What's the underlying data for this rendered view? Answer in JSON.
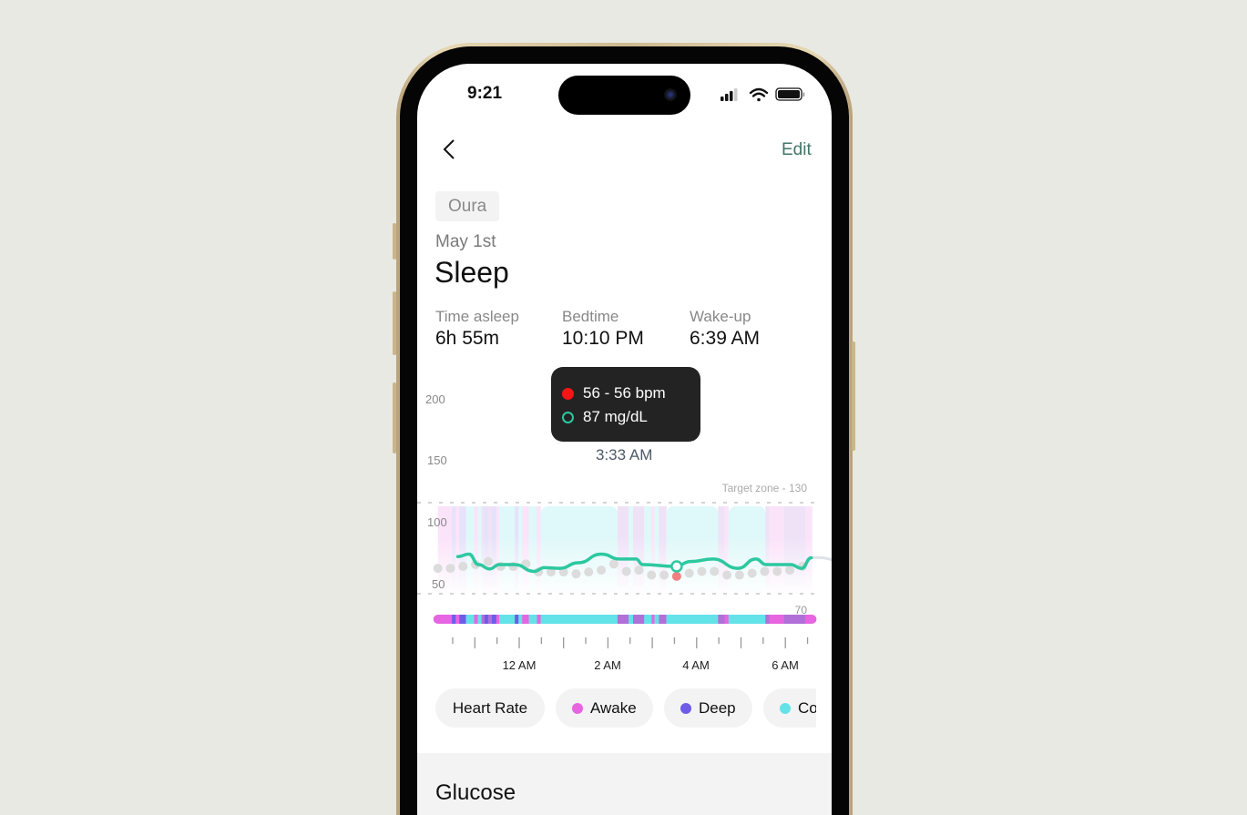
{
  "status_bar": {
    "time": "9:21",
    "icons": [
      "signal-icon",
      "wifi-icon",
      "battery-icon"
    ]
  },
  "nav": {
    "back_icon": "chevron-left-icon",
    "edit_label": "Edit"
  },
  "source_chip": "Oura",
  "date": "May 1st",
  "title": "Sleep",
  "stats": [
    {
      "label": "Time asleep",
      "value": "6h 55m"
    },
    {
      "label": "Bedtime",
      "value": "10:10 PM"
    },
    {
      "label": "Wake-up",
      "value": "6:39 AM"
    }
  ],
  "tooltip": {
    "heart_rate": "56 - 56 bpm",
    "glucose": "87 mg/dL",
    "time": "3:33 AM"
  },
  "legend_pills": [
    {
      "label": "Heart Rate",
      "color": ""
    },
    {
      "label": "Awake",
      "color": "#e765e0"
    },
    {
      "label": "Deep",
      "color": "#6e5ce8"
    },
    {
      "label": "Co",
      "color": "#63e3e8"
    }
  ],
  "next_section_title": "Glucose",
  "colors": {
    "glucose_line": "#2dc8a0",
    "heart_rate_dot": "#dcdcdc",
    "highlight_dot": "#f08080",
    "awake": "#e765e0",
    "deep": "#6e5ce8",
    "core": "#63e3e8",
    "rem": "#b070d8",
    "accent": "#3f7668"
  },
  "chart_data": {
    "type": "line",
    "ylim": [
      50,
      200
    ],
    "y_ticks": [
      "200",
      "150",
      "100",
      "50"
    ],
    "x_ticks": [
      "12 AM",
      "2 AM",
      "4 AM",
      "6 AM"
    ],
    "target_zone_label": "Target zone - 130",
    "stage_bar_label": "70",
    "highlight_time": "03:33",
    "series": [
      {
        "name": "Glucose",
        "unit": "mg/dL",
        "points": [
          [
            "22:37",
            72
          ],
          [
            "22:52",
            74
          ],
          [
            "23:05",
            65.5
          ],
          [
            "23:20",
            62
          ],
          [
            "23:33",
            65.5
          ],
          [
            "23:54",
            65.5
          ],
          [
            "00:20",
            60
          ],
          [
            "00:34",
            63
          ],
          [
            "00:55",
            62.5
          ],
          [
            "01:20",
            67
          ],
          [
            "01:51",
            74
          ],
          [
            "02:16",
            70
          ],
          [
            "02:38",
            70
          ],
          [
            "02:47",
            65.5
          ],
          [
            "03:31",
            64
          ],
          [
            "03:52",
            68
          ],
          [
            "04:22",
            70
          ],
          [
            "04:56",
            62.5
          ],
          [
            "05:20",
            70
          ],
          [
            "05:34",
            65.5
          ],
          [
            "06:07",
            65.5
          ],
          [
            "06:22",
            62.5
          ],
          [
            "06:35",
            71
          ]
        ]
      },
      {
        "name": "Heart Rate",
        "unit": "bpm",
        "points": [
          [
            "22:10",
            62.5
          ],
          [
            "22:27",
            62.5
          ],
          [
            "22:44",
            64
          ],
          [
            "23:01",
            65.5
          ],
          [
            "23:18",
            68
          ],
          [
            "23:35",
            64
          ],
          [
            "23:52",
            64
          ],
          [
            "00:09",
            66
          ],
          [
            "00:26",
            59.5
          ],
          [
            "00:43",
            59.5
          ],
          [
            "01:00",
            59.5
          ],
          [
            "01:17",
            58
          ],
          [
            "01:34",
            59.5
          ],
          [
            "01:51",
            61
          ],
          [
            "02:08",
            66
          ],
          [
            "02:25",
            60
          ],
          [
            "02:42",
            61
          ],
          [
            "02:59",
            57
          ],
          [
            "03:16",
            57
          ],
          [
            "03:33",
            56
          ],
          [
            "03:50",
            58.5
          ],
          [
            "04:07",
            60
          ],
          [
            "04:24",
            60
          ],
          [
            "04:41",
            57
          ],
          [
            "04:58",
            57
          ],
          [
            "05:15",
            58.5
          ],
          [
            "05:32",
            60
          ],
          [
            "05:49",
            60
          ],
          [
            "06:06",
            61
          ],
          [
            "06:23",
            64
          ]
        ]
      }
    ],
    "sleep_stages_start": "22:10",
    "sleep_stages": [
      [
        "awake",
        19
      ],
      [
        "deep",
        5
      ],
      [
        "awake",
        5
      ],
      [
        "deep",
        9
      ],
      [
        "core",
        11
      ],
      [
        "awake",
        5
      ],
      [
        "core",
        5
      ],
      [
        "rem",
        4
      ],
      [
        "deep",
        5
      ],
      [
        "rem",
        5
      ],
      [
        "deep",
        6
      ],
      [
        "awake",
        4
      ],
      [
        "core",
        21
      ],
      [
        "deep",
        5
      ],
      [
        "core",
        5
      ],
      [
        "awake",
        9
      ],
      [
        "core",
        11
      ],
      [
        "awake",
        5
      ],
      [
        "core",
        104
      ],
      [
        "rem",
        15
      ],
      [
        "core",
        6
      ],
      [
        "rem",
        15
      ],
      [
        "core",
        10
      ],
      [
        "awake",
        4
      ],
      [
        "core",
        6
      ],
      [
        "rem",
        10
      ],
      [
        "core",
        70
      ],
      [
        "rem",
        9
      ],
      [
        "awake",
        5
      ],
      [
        "core",
        50
      ],
      [
        "rem",
        5
      ],
      [
        "awake",
        20
      ],
      [
        "rem",
        29
      ],
      [
        "awake",
        9
      ]
    ]
  }
}
